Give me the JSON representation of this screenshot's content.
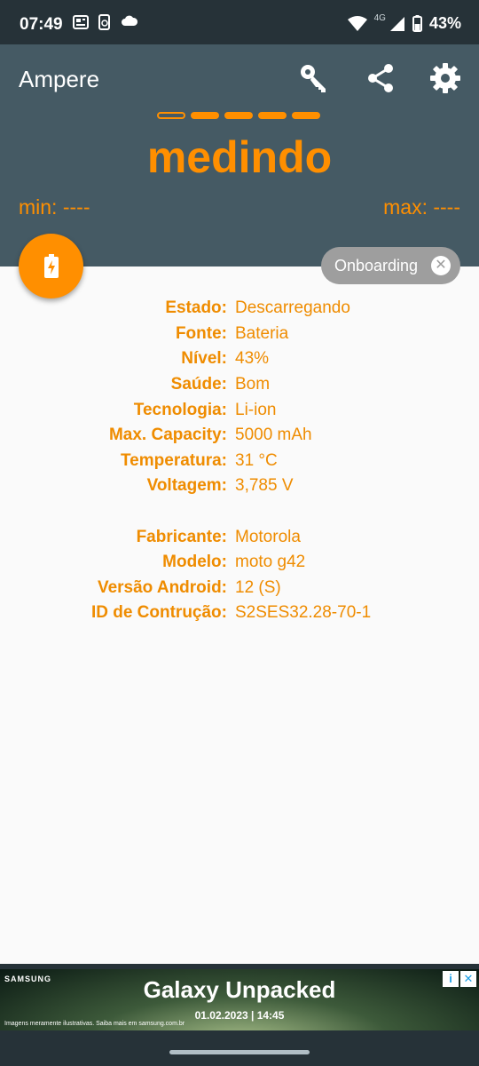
{
  "status_bar": {
    "time": "07:49",
    "network": "4G",
    "battery_text": "43%"
  },
  "header": {
    "app_title": "Ampere",
    "status_word": "medindo",
    "min_label": "min: ----",
    "max_label": "max: ----",
    "accent_color": "#ff8f00",
    "background_color": "#455a64"
  },
  "icons": {
    "key": "key-icon",
    "share": "share-icon",
    "settings": "gear-icon",
    "fab": "battery-charging-icon"
  },
  "chip": {
    "label": "Onboarding",
    "close": "✕"
  },
  "info": {
    "rows1": [
      {
        "label": "Estado:",
        "value": "Descarregando"
      },
      {
        "label": "Fonte:",
        "value": "Bateria"
      },
      {
        "label": "Nível:",
        "value": "43%"
      },
      {
        "label": "Saúde:",
        "value": "Bom"
      },
      {
        "label": "Tecnologia:",
        "value": "Li-ion"
      },
      {
        "label": "Max. Capacity:",
        "value": "5000 mAh"
      },
      {
        "label": "Temperatura:",
        "value": "31 °C"
      },
      {
        "label": "Voltagem:",
        "value": "3,785 V"
      }
    ],
    "rows2": [
      {
        "label": "Fabricante:",
        "value": "Motorola"
      },
      {
        "label": "Modelo:",
        "value": "moto g42"
      },
      {
        "label": "Versão Android:",
        "value": "12 (S)"
      },
      {
        "label": "ID de Contrução:",
        "value": "S2SES32.28-70-1"
      }
    ]
  },
  "ad": {
    "brand": "SAMSUNG",
    "headline": "Galaxy Unpacked",
    "date": "01.02.2023 | 14:45",
    "fine_print": "Imagens meramente ilustrativas. Saiba mais em samsung.com.br",
    "info_glyph": "i",
    "close_glyph": "✕"
  }
}
